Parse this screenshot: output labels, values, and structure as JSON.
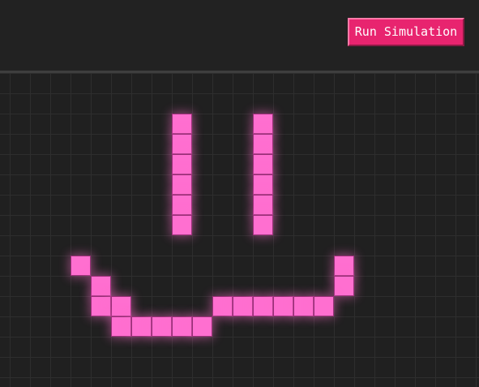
{
  "toolbar": {
    "run_label": "Run Simulation"
  },
  "colors": {
    "background": "#202020",
    "grid_line": "#2e2e2e",
    "live_cell": "#ff6fd0",
    "button_bg": "#e8246f",
    "button_text": "#ffffff"
  },
  "grid": {
    "live_cells": [
      [
        8,
        2
      ],
      [
        8,
        3
      ],
      [
        8,
        4
      ],
      [
        8,
        5
      ],
      [
        8,
        6
      ],
      [
        8,
        7
      ],
      [
        12,
        2
      ],
      [
        12,
        3
      ],
      [
        12,
        4
      ],
      [
        12,
        5
      ],
      [
        12,
        6
      ],
      [
        12,
        7
      ],
      [
        3,
        9
      ],
      [
        16,
        9
      ],
      [
        4,
        10
      ],
      [
        16,
        10
      ],
      [
        4,
        11
      ],
      [
        5,
        11
      ],
      [
        10,
        11
      ],
      [
        11,
        11
      ],
      [
        12,
        11
      ],
      [
        13,
        11
      ],
      [
        14,
        11
      ],
      [
        15,
        11
      ],
      [
        5,
        12
      ],
      [
        6,
        12
      ],
      [
        7,
        12
      ],
      [
        8,
        12
      ],
      [
        9,
        12
      ]
    ]
  }
}
